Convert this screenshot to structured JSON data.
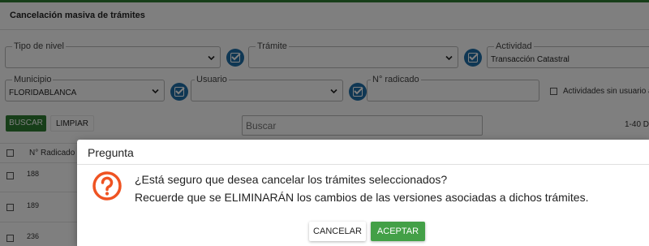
{
  "page": {
    "title": "Cancelación masiva de trámites"
  },
  "filters": {
    "tipo_nivel": {
      "label": "Tipo de nivel",
      "value": ""
    },
    "tramite": {
      "label": "Trámite",
      "value": ""
    },
    "actividad": {
      "label": "Actividad",
      "value": "Transacción Catastral"
    },
    "municipio": {
      "label": "Municipio",
      "value": "FLORIDABLANCA"
    },
    "usuario": {
      "label": "Usuario",
      "value": ""
    },
    "radicado": {
      "label": "N° radicado",
      "value": ""
    },
    "actividades_sin_usuario": {
      "label": "Actividades sin usuario a",
      "checked": false
    }
  },
  "actions": {
    "buscar_label": "BUSCAR",
    "limpiar_label": "LIMPIAR",
    "search_placeholder": "Buscar",
    "range_text": "1-40 D"
  },
  "table": {
    "header_radicado": "N° Radicado",
    "rows": [
      "188",
      "189",
      "236"
    ]
  },
  "dialog": {
    "title": "Pregunta",
    "line1": "¿Está seguro que desea cancelar los trámites seleccionados?",
    "line2": "Recuerde que se ELIMINARÁN los cambios de las versiones asociadas a dichos trámites.",
    "cancel_label": "CANCELAR",
    "accept_label": "ACEPTAR",
    "icon": "question-circle-icon",
    "icon_color": "#ef5322",
    "accept_color": "#43a047"
  },
  "colors": {
    "primary_green": "#2e7d32",
    "check_blue": "#1e6fa8"
  }
}
